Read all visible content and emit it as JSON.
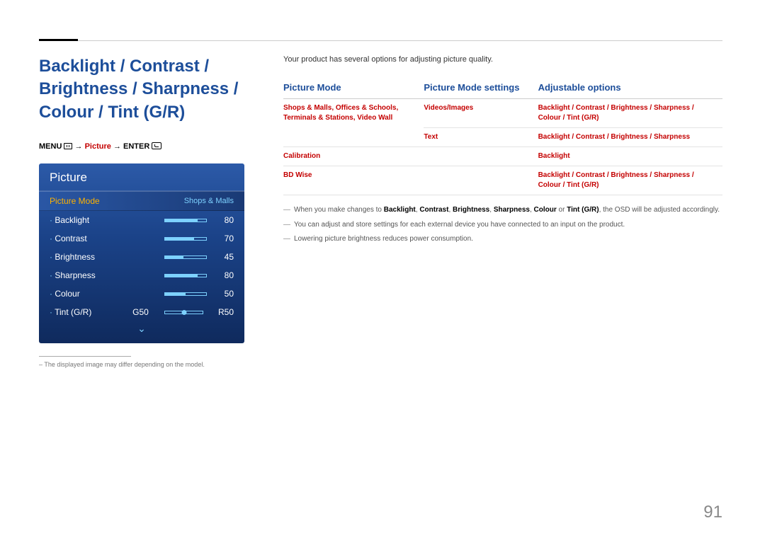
{
  "title": "Backlight / Contrast / Brightness / Sharpness / Colour / Tint (G/R)",
  "menupath": {
    "menu": "MENU",
    "arrow1": "→",
    "pic": "Picture",
    "arrow2": "→",
    "enter": "ENTER"
  },
  "osd": {
    "header": "Picture",
    "selected": {
      "label": "Picture Mode",
      "value": "Shops & Malls"
    },
    "items": [
      {
        "label": "Backlight",
        "value": "80",
        "fill": 80
      },
      {
        "label": "Contrast",
        "value": "70",
        "fill": 70
      },
      {
        "label": "Brightness",
        "value": "45",
        "fill": 45
      },
      {
        "label": "Sharpness",
        "value": "80",
        "fill": 80
      },
      {
        "label": "Colour",
        "value": "50",
        "fill": 50
      }
    ],
    "tint": {
      "label": "Tint (G/R)",
      "g": "G50",
      "r": "R50",
      "pos": 50
    }
  },
  "footnote": "The displayed image may differ depending on the model.",
  "intro": "Your product has several options for adjusting picture quality.",
  "table": {
    "headers": {
      "mode": "Picture Mode",
      "settings": "Picture Mode settings",
      "adj": "Adjustable options"
    },
    "rows": [
      {
        "mode": "Shops & Malls, Offices & Schools, Terminals & Stations, Video Wall",
        "settings": "Videos/Images",
        "adj": "Backlight / Contrast / Brightness / Sharpness / Colour / Tint (G/R)"
      },
      {
        "mode": "",
        "settings": "Text",
        "adj": "Backlight / Contrast / Brightness / Sharpness"
      },
      {
        "mode": "Calibration",
        "settings": "",
        "adj": "Backlight"
      },
      {
        "mode": "BD Wise",
        "settings": "",
        "adj": "Backlight / Contrast / Brightness / Sharpness / Colour / Tint (G/R)"
      }
    ]
  },
  "notes": {
    "n1a": "When you make changes to ",
    "n1_bold": [
      "Backlight",
      "Contrast",
      "Brightness",
      "Sharpness",
      "Colour",
      "Tint (G/R)"
    ],
    "n1_or": " or ",
    "n1b": ", the OSD will be adjusted accordingly.",
    "n2": "You can adjust and store settings for each external device you have connected to an input on the product.",
    "n3": "Lowering picture brightness reduces power consumption."
  },
  "pagenum": "91"
}
